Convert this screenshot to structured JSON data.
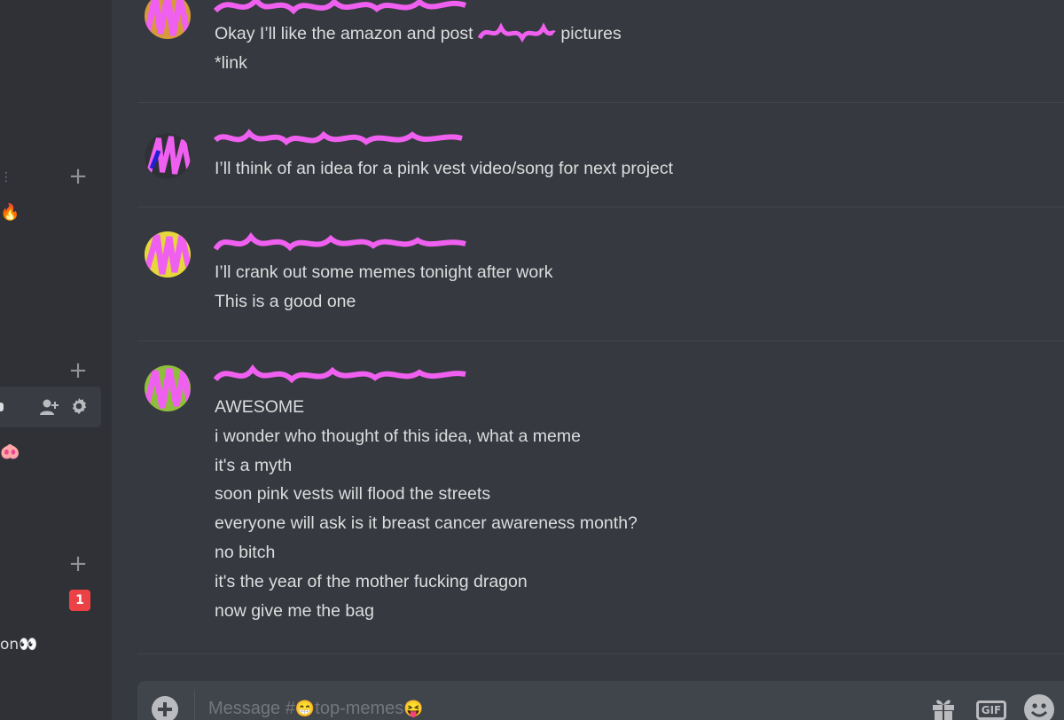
{
  "sidebar": {
    "badge_count": "1",
    "channel_partial": "on",
    "emojis": {
      "fire": "🔥",
      "pig": "🐽",
      "eyes": "👀"
    }
  },
  "messages": [
    {
      "lines": [
        "Okay I’ll like the amazon and post",
        "pictures",
        "*link"
      ]
    },
    {
      "lines": [
        "I’ll think of an idea for a pink vest video/song for next project"
      ]
    },
    {
      "lines": [
        "I’ll crank out some memes tonight after work",
        "This is a good one"
      ]
    },
    {
      "lines": [
        "AWESOME",
        "i wonder who thought of this idea, what a meme",
        "it's a myth",
        "soon pink vests will flood the streets",
        "everyone will ask is it breast cancer awareness month?",
        "no bitch",
        "it's the year of the mother fucking dragon",
        "now give me the bag"
      ]
    }
  ],
  "composer": {
    "placeholder_prefix": "Message #",
    "channel_emoji_1": "😁",
    "channel_name": "top-memes",
    "channel_emoji_2": "😝",
    "gif_label": "GIF"
  },
  "colors": {
    "background": "#36393f",
    "sidebar": "#2f3136",
    "text": "#dcddde",
    "scribble": "#f060f0",
    "badge": "#ed4245"
  }
}
